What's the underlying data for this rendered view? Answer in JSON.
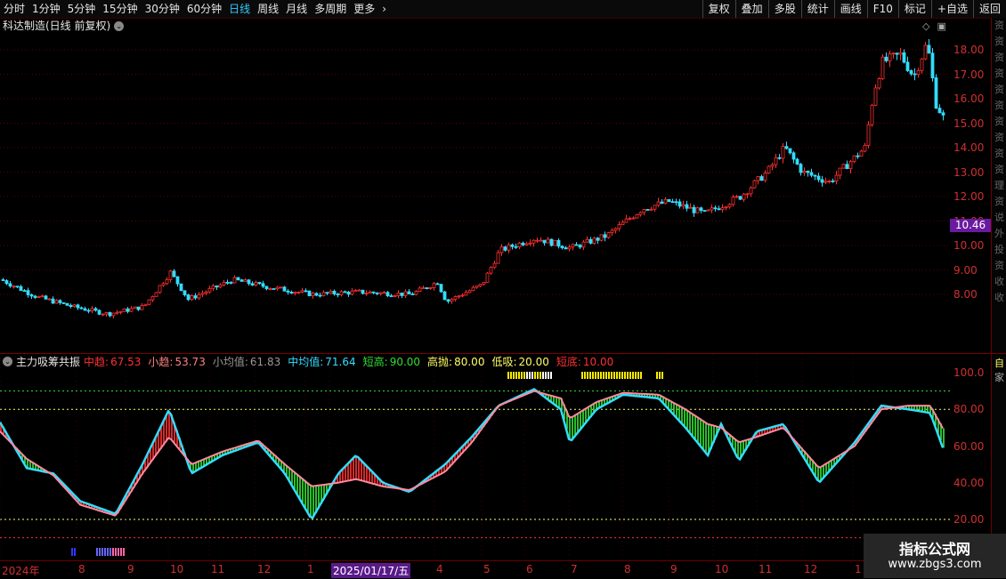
{
  "toolbar": {
    "periods": [
      "分时",
      "1分钟",
      "5分钟",
      "15分钟",
      "30分钟",
      "60分钟",
      "日线",
      "周线",
      "月线",
      "多周期",
      "更多"
    ],
    "active_period": "日线",
    "right_buttons": [
      "复权",
      "叠加",
      "多股",
      "统计",
      "画线",
      "F10",
      "标记",
      "+自选",
      "返回"
    ]
  },
  "main_chart": {
    "title": "科达制造(日线 前复权)",
    "y_ticks": [
      "18.00",
      "17.00",
      "16.00",
      "15.00",
      "14.00",
      "13.00",
      "12.00",
      "11.00",
      "10.00",
      "9.00",
      "8.00"
    ],
    "last_price": "10.46"
  },
  "indicator": {
    "name": "主力吸筹共振",
    "legend": [
      {
        "label": "中趋:",
        "value": "67.53",
        "color": "#ff3030"
      },
      {
        "label": "小趋:",
        "value": "53.73",
        "color": "#ff8080"
      },
      {
        "label": "小均值:",
        "value": "61.83",
        "color": "#999999"
      },
      {
        "label": "中均值:",
        "value": "71.64",
        "color": "#33ddff"
      },
      {
        "label": "短高:",
        "value": "90.00",
        "color": "#33dd33"
      },
      {
        "label": "高抛:",
        "value": "80.00",
        "color": "#ffff66"
      },
      {
        "label": "低吸:",
        "value": "20.00",
        "color": "#ffff66"
      },
      {
        "label": "短底:",
        "value": "10.00",
        "color": "#ff3030"
      }
    ],
    "y_ticks": [
      "100.0",
      "80.00",
      "60.00",
      "40.00",
      "20.00"
    ]
  },
  "date_axis": {
    "labels": [
      "2024年",
      "8",
      "9",
      "10",
      "11",
      "12",
      "1",
      "2025/01/17/五",
      "4",
      "5",
      "6",
      "7",
      "8",
      "9",
      "10",
      "11",
      "12",
      "1"
    ],
    "highlight": "2025/01/17/五"
  },
  "right_strip_glyphs": [
    "资",
    "资",
    "资",
    "资",
    "资",
    "资",
    "资",
    "资",
    "资",
    "资",
    "理",
    "资",
    "说",
    "外",
    "投",
    "资",
    "收",
    "收"
  ],
  "watermark": {
    "title": "指标公式网",
    "url": "www.zbgs3.com"
  },
  "colors": {
    "up": "#ff3030",
    "down": "#33ddff",
    "grid": "#6a0000",
    "accent": "#33ccff"
  }
}
